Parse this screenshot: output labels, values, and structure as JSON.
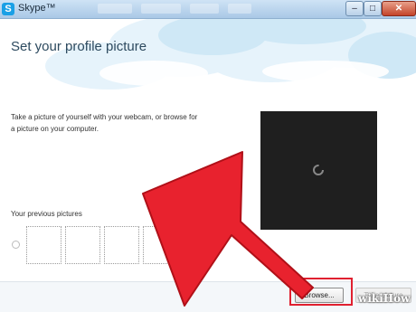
{
  "window": {
    "title": "Skype™",
    "app_icon_letter": "S",
    "controls": {
      "minimize": "–",
      "maximize": "□",
      "close": "✕"
    }
  },
  "page": {
    "heading": "Set your profile picture",
    "description": "Take a picture of yourself with your webcam, or browse for a picture on your computer.",
    "previous_pictures_label": "Your previous pictures"
  },
  "buttons": {
    "browse": "Browse...",
    "take_picture": "Take picture"
  },
  "annotation": {
    "arrow_color": "#e8222e",
    "highlight_color": "#e02030"
  },
  "watermark": {
    "prefix": "wiki",
    "suffix": "How"
  },
  "colors": {
    "heading": "#2d4a5f",
    "webcam_bg": "#1f1f1f",
    "titlebar": "#a9c8e6"
  }
}
